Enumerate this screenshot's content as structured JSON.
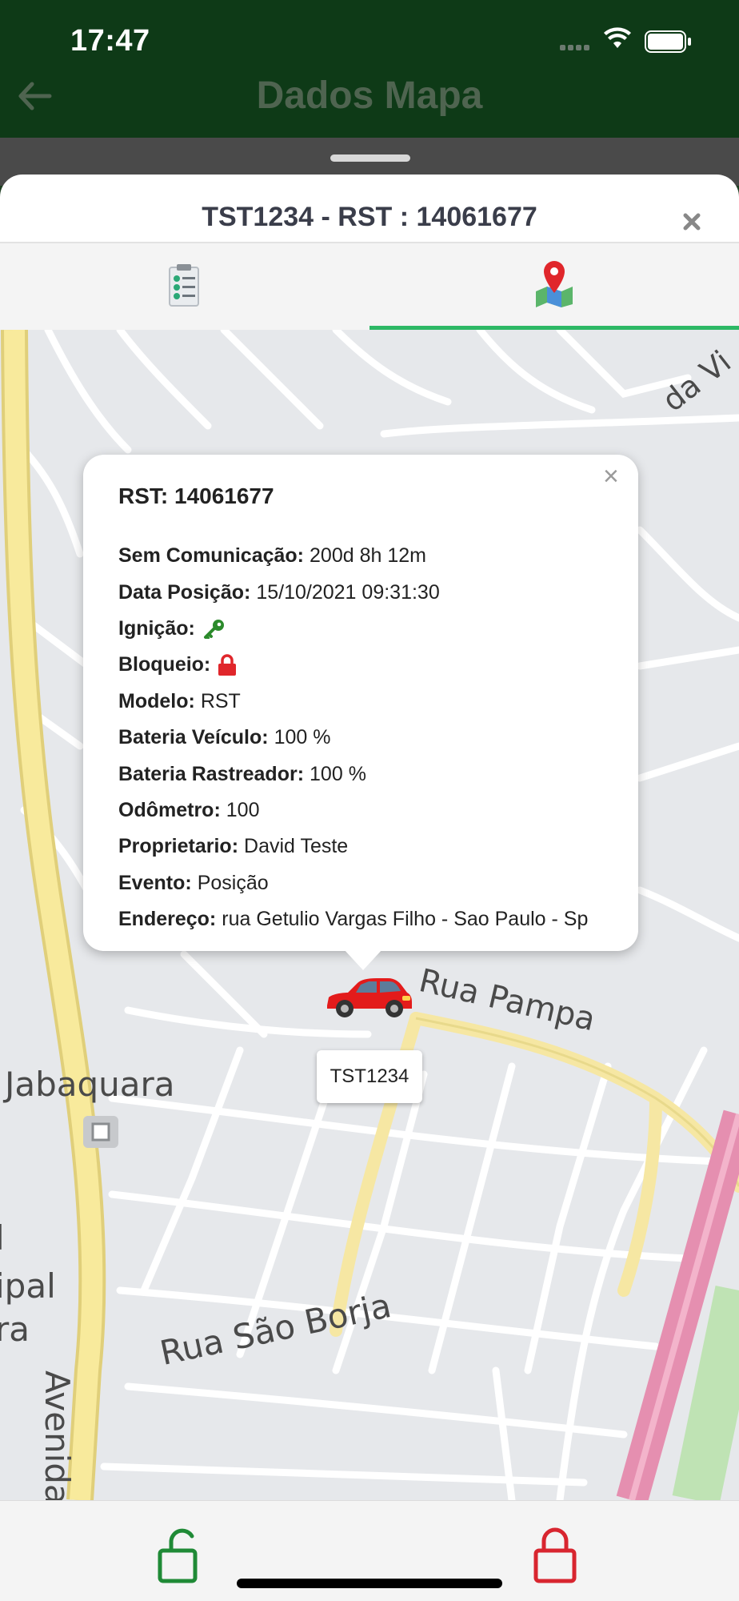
{
  "status_bar": {
    "time": "17:47"
  },
  "header": {
    "title": "Dados Mapa"
  },
  "sheet": {
    "title": "TST1234 - RST : 14061677"
  },
  "tabs": [
    {
      "icon": "checklist-icon"
    },
    {
      "icon": "map-pin-icon",
      "active": true
    }
  ],
  "popup": {
    "title": "RST: 14061677",
    "rows": [
      {
        "label": "Sem Comunicação:",
        "value": "200d 8h 12m"
      },
      {
        "label": "Data Posição:",
        "value": "15/10/2021 09:31:30"
      },
      {
        "label": "Ignição:",
        "value": "",
        "icon": "key-icon"
      },
      {
        "label": "Bloqueio:",
        "value": "",
        "icon": "lock-icon"
      },
      {
        "label": "Modelo:",
        "value": "RST"
      },
      {
        "label": "Bateria Veículo:",
        "value": "100 %"
      },
      {
        "label": "Bateria Rastreador:",
        "value": "100 %"
      },
      {
        "label": "Odômetro:",
        "value": "100"
      },
      {
        "label": "Proprietario:",
        "value": "David Teste"
      },
      {
        "label": "Evento:",
        "value": "Posição"
      },
      {
        "label": "Endereço:",
        "value": "rua Getulio Vargas Filho - Sao Paulo - Sp"
      }
    ]
  },
  "map": {
    "marker_label": "TST1234",
    "street_labels": {
      "rua_pampa": "Rua Pampa",
      "jabaquara": "Jabaquara",
      "rua_sao_borja": "Rua São Borja",
      "avenida": "Avenida",
      "da_vi": "da Vi",
      "ipal": "ipal",
      "l": "l",
      "ra": "ra"
    }
  },
  "colors": {
    "header_bg": "#0e3a17",
    "tab_active": "#2db865",
    "unlock": "#1f8a36",
    "lock": "#d8252f"
  }
}
